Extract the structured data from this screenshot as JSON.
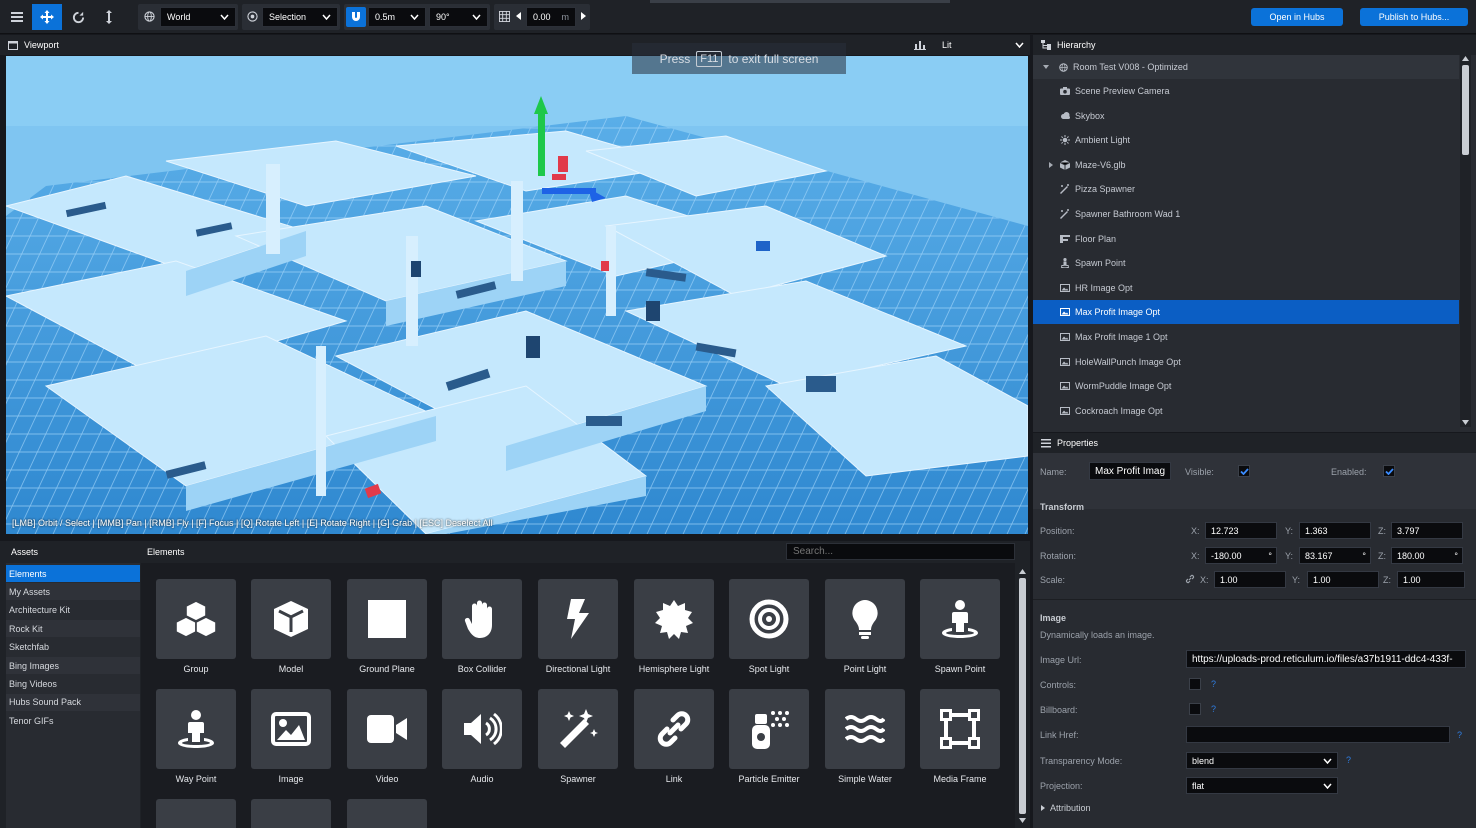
{
  "toolbar": {
    "space_select": "World",
    "pivot_select": "Selection",
    "snap_translate": "0.5m",
    "snap_rotate": "90°",
    "grid_value": "0.00",
    "grid_unit": "m",
    "open_in_hubs": "Open in Hubs",
    "publish": "Publish to Hubs..."
  },
  "viewport": {
    "title": "Viewport",
    "render_mode": "Lit",
    "fullscreen_press": "Press",
    "fullscreen_key": "F11",
    "fullscreen_msg": "to exit full screen",
    "controls_hint": "[LMB] Orbit / Select | [MMB] Pan | [RMB] Fly | [F] Focus | [Q] Rotate Left | [E] Rotate Right | [G] Grab | [ESC] Deselect All"
  },
  "hierarchy": {
    "title": "Hierarchy",
    "root": "Room Test V008 - Optimized",
    "items": [
      {
        "label": "Scene Preview Camera",
        "icon": "camera-icon"
      },
      {
        "label": "Skybox",
        "icon": "cloud-icon"
      },
      {
        "label": "Ambient Light",
        "icon": "sun-icon"
      },
      {
        "label": "Maze-V6.glb",
        "icon": "cube-icon"
      },
      {
        "label": "Pizza Spawner",
        "icon": "wand-icon"
      },
      {
        "label": "Spawner Bathroom Wad 1",
        "icon": "wand-icon"
      },
      {
        "label": "Floor Plan",
        "icon": "floor-plan-icon"
      },
      {
        "label": "Spawn Point",
        "icon": "person-icon"
      },
      {
        "label": "HR Image Opt",
        "icon": "image-icon"
      },
      {
        "label": "Max Profit Image Opt",
        "icon": "image-icon"
      },
      {
        "label": "Max Profit Image 1 Opt",
        "icon": "image-icon"
      },
      {
        "label": "HoleWallPunch Image Opt",
        "icon": "image-icon"
      },
      {
        "label": "WormPuddle Image Opt",
        "icon": "image-icon"
      },
      {
        "label": "Cockroach Image Opt",
        "icon": "image-icon"
      }
    ]
  },
  "properties": {
    "title": "Properties",
    "name_label": "Name:",
    "name_value": "Max Profit Imag",
    "visible_label": "Visible:",
    "enabled_label": "Enabled:",
    "transform_title": "Transform",
    "position_label": "Position:",
    "rotation_label": "Rotation:",
    "scale_label": "Scale:",
    "axis_x": "X:",
    "axis_y": "Y:",
    "axis_z": "Z:",
    "position": {
      "x": "12.723",
      "y": "1.363",
      "z": "3.797"
    },
    "rotation": {
      "x": "-180.00",
      "y": "83.167",
      "z": "180.00",
      "unit": "°"
    },
    "scale": {
      "x": "1.00",
      "y": "1.00",
      "z": "1.00"
    },
    "image_title": "Image",
    "image_desc": "Dynamically loads an image.",
    "image_url_label": "Image Url:",
    "image_url": "https://uploads-prod.reticulum.io/files/a37b1911-ddc4-433f-",
    "controls_label": "Controls:",
    "billboard_label": "Billboard:",
    "link_href_label": "Link Href:",
    "transparency_label": "Transparency Mode:",
    "transparency_value": "blend",
    "projection_label": "Projection:",
    "projection_value": "flat",
    "attribution_label": "Attribution",
    "help_mark": "?"
  },
  "assets": {
    "title": "Assets",
    "sources": [
      "Elements",
      "My Assets",
      "Architecture Kit",
      "Rock Kit",
      "Sketchfab",
      "Bing Images",
      "Bing Videos",
      "Hubs Sound Pack",
      "Tenor GIFs"
    ],
    "elements_title": "Elements",
    "search_placeholder": "Search...",
    "elements": [
      {
        "label": "Group",
        "icon": "group-icon"
      },
      {
        "label": "Model",
        "icon": "model-icon"
      },
      {
        "label": "Ground Plane",
        "icon": "ground-plane-icon"
      },
      {
        "label": "Box Collider",
        "icon": "hand-icon"
      },
      {
        "label": "Directional Light",
        "icon": "bolt-icon"
      },
      {
        "label": "Hemisphere Light",
        "icon": "certificate-icon"
      },
      {
        "label": "Spot Light",
        "icon": "bullseye-icon"
      },
      {
        "label": "Point Light",
        "icon": "lightbulb-icon"
      },
      {
        "label": "Spawn Point",
        "icon": "street-view-icon"
      },
      {
        "label": "Way Point",
        "icon": "street-view-icon"
      },
      {
        "label": "Image",
        "icon": "image-icon"
      },
      {
        "label": "Video",
        "icon": "video-icon"
      },
      {
        "label": "Audio",
        "icon": "volume-icon"
      },
      {
        "label": "Spawner",
        "icon": "magic-icon"
      },
      {
        "label": "Link",
        "icon": "link-icon"
      },
      {
        "label": "Particle Emitter",
        "icon": "spray-can-icon"
      },
      {
        "label": "Simple Water",
        "icon": "water-icon"
      },
      {
        "label": "Media Frame",
        "icon": "vector-square-icon"
      }
    ]
  }
}
